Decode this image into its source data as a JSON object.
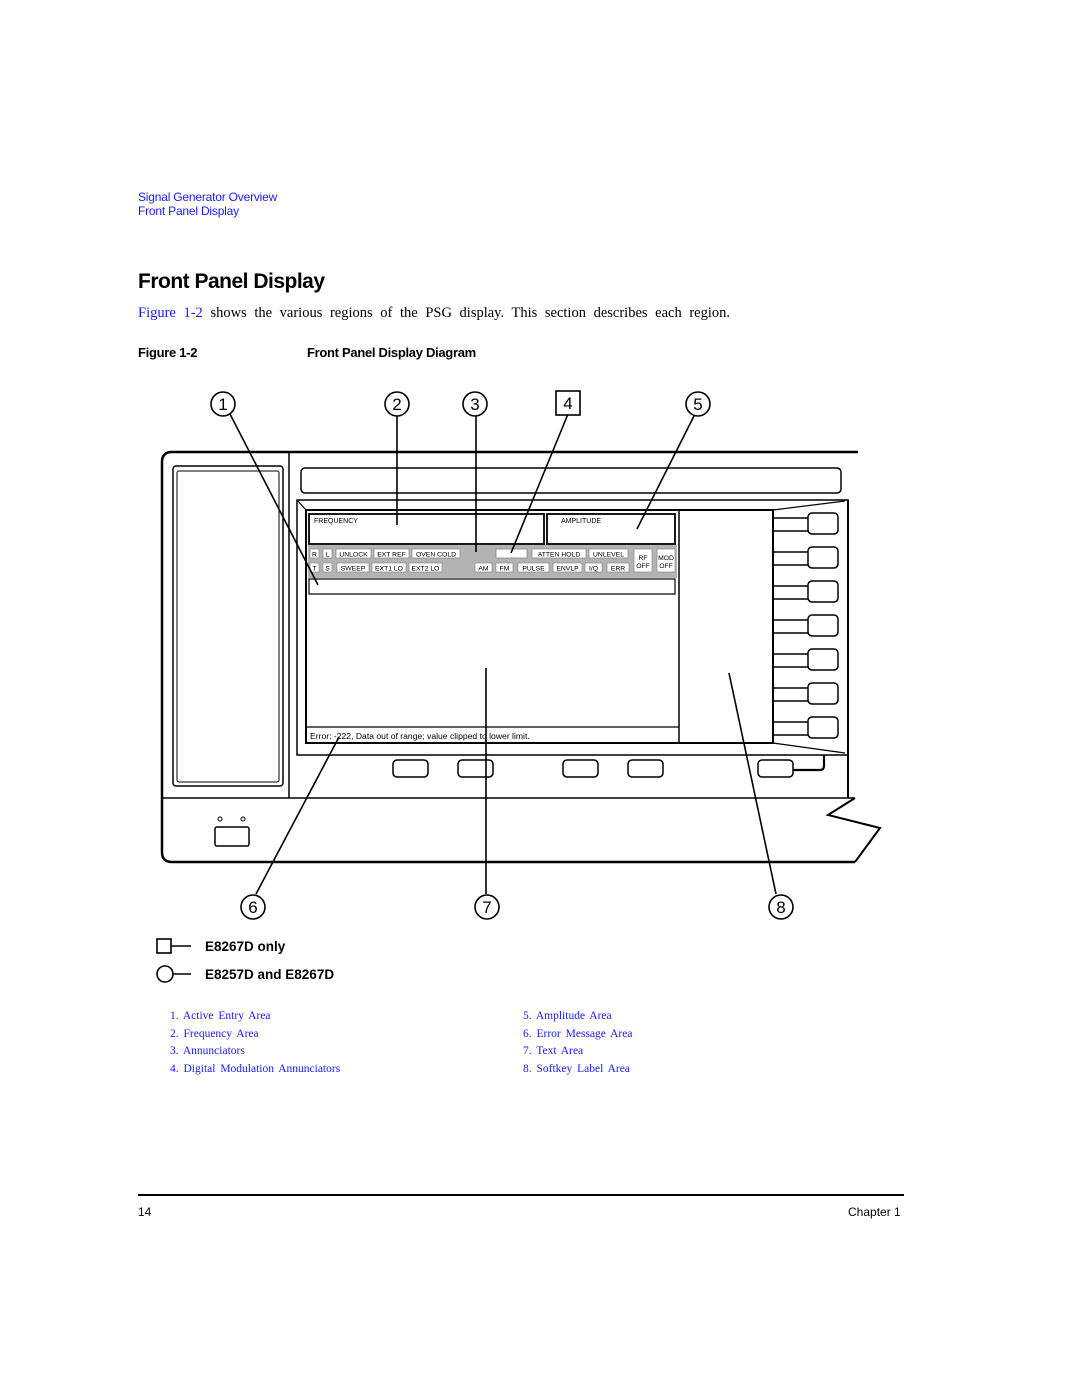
{
  "breadcrumb": [
    "Signal Generator Overview",
    "Front Panel Display"
  ],
  "page_title": "Front Panel Display",
  "intro": {
    "link_text": "Figure 1-2",
    "text": " shows the various regions of the PSG display. This section describes each region."
  },
  "figure": {
    "number": "Figure 1-2",
    "title": "Front Panel Display Diagram"
  },
  "diagram": {
    "callouts_top": [
      "1",
      "2",
      "3",
      "4",
      "5"
    ],
    "callouts_bottom": [
      "6",
      "7",
      "8"
    ],
    "frequency_label": "FREQUENCY",
    "amplitude_label": "AMPLITUDE",
    "annunciators_row1": [
      "R",
      "L",
      "UNLOCK",
      "EXT REF",
      "OVEN COLD"
    ],
    "annunciators_row1_right": [
      "ATTEN HOLD",
      "UNLEVEL"
    ],
    "annunciators_row2": [
      "T",
      "S",
      "SWEEP",
      "EXT1 LO",
      "EXT2 LO"
    ],
    "annunciators_row2_right": [
      "AM",
      "FM",
      "PULSE",
      "ENVLP",
      "I/Q",
      "ERR"
    ],
    "rf_off": [
      "RF",
      "OFF"
    ],
    "mod_off": [
      "MOD",
      "OFF"
    ],
    "error_message": "Error: -222, Data out of range;  value clipped to lower limit."
  },
  "legend": [
    {
      "symbol": "square",
      "label": "E8267D only"
    },
    {
      "symbol": "circle",
      "label": "E8257D and E8267D"
    }
  ],
  "regions": [
    "1. Active Entry Area",
    "2. Frequency Area",
    "3. Annunciators",
    "4. Digital Modulation Annunciators",
    "5. Amplitude Area",
    "6. Error Message Area",
    "7. Text Area",
    "8. Softkey Label Area"
  ],
  "footer": {
    "page_number": "14",
    "chapter": "Chapter 1"
  }
}
